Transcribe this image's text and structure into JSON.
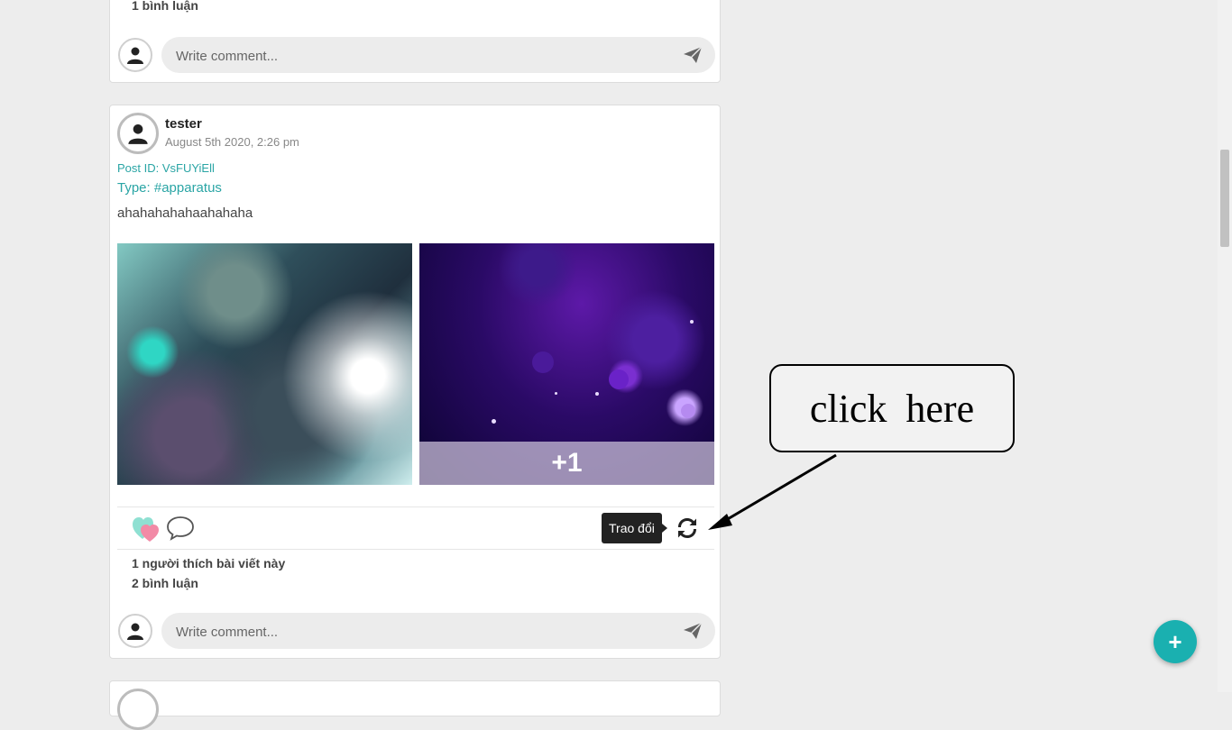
{
  "top_post": {
    "comments_count": "1 bình luận",
    "comment_placeholder": "Write comment..."
  },
  "post": {
    "author": "tester",
    "date": "August 5th 2020, 2:26 pm",
    "post_id": "Post ID: VsFUYiEll",
    "type": "Type: #apparatus",
    "content": "ahahahahahaahahaha",
    "more_images": "+1",
    "exchange_tooltip": "Trao đổi",
    "likes_text": "1 người thích bài viết này",
    "comments_count": "2 bình luận",
    "comment_placeholder": "Write comment..."
  },
  "fab_label": "+",
  "annotation": {
    "text": "click here"
  },
  "icons": {
    "avatar": "user-avatar-icon",
    "send": "paper-plane-icon",
    "like": "hearts-icon",
    "comment": "speech-bubble-icon",
    "exchange": "refresh-arrows-icon"
  },
  "colors": {
    "accent": "#1ab0b0",
    "link": "#2aa5a5",
    "background": "#ededed"
  }
}
